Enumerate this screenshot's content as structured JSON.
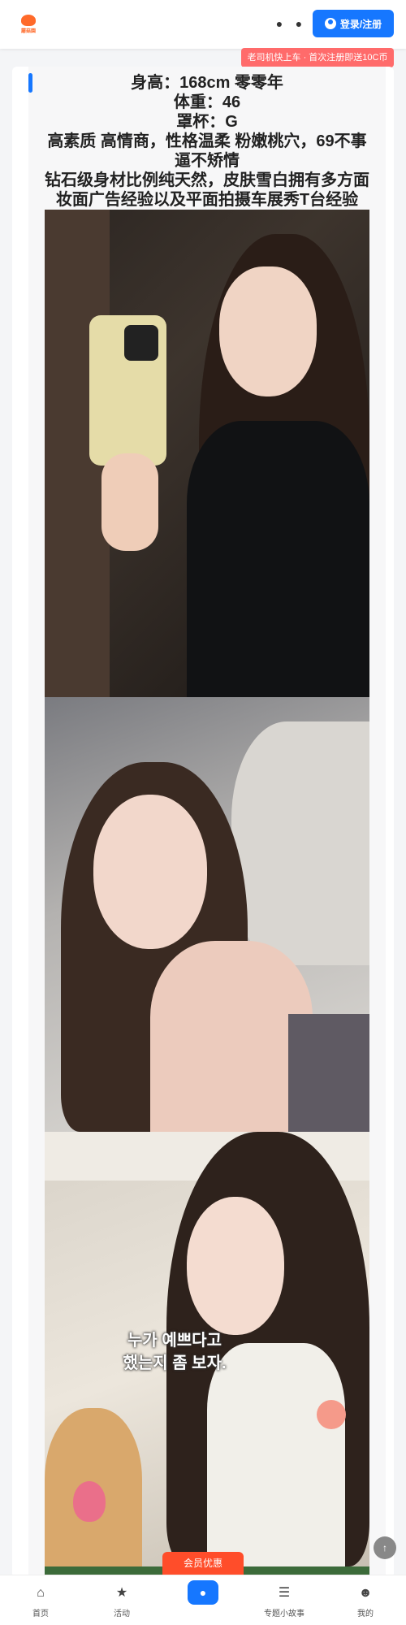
{
  "header": {
    "logo_text": "蘑菇園",
    "login_label": "登录/注册",
    "promo_text": "老司机快上车 · 首次注册即送10C币"
  },
  "profile": {
    "lines": [
      "身高：168cm  零零年",
      "体重：46",
      "罩杯：G",
      "高素质  高情商，性格温柔 粉嫩桃穴，69不事逼不矫情",
      "钻石级身材比例纯天然，皮肤雪白拥有多方面妆面广告经验以及平面拍摄车展秀T台经验"
    ]
  },
  "photos": {
    "overlay_text_1": "누가 예쁘다고",
    "overlay_text_2": "했는지 좀 보자."
  },
  "vip_label": "会员优惠",
  "nav": [
    {
      "label": "首页",
      "icon": "home-icon"
    },
    {
      "label": "活动",
      "icon": "activity-icon"
    },
    {
      "label": "",
      "icon": "center-icon"
    },
    {
      "label": "专题小故事",
      "icon": "story-icon"
    },
    {
      "label": "我的",
      "icon": "profile-icon"
    }
  ]
}
